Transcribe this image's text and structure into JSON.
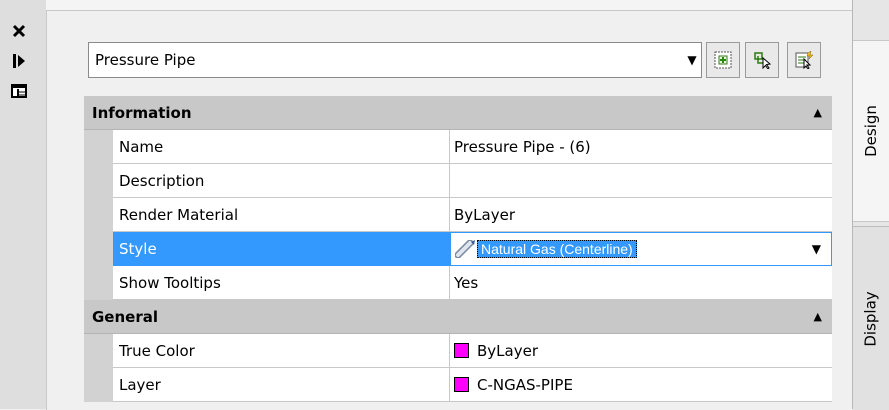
{
  "combo": {
    "value": "Pressure Pipe"
  },
  "tabs": {
    "design": "Design",
    "display": "Display"
  },
  "categories": [
    {
      "title": "Information",
      "rows": [
        {
          "name": "Name",
          "value": "Pressure Pipe - (6)"
        },
        {
          "name": "Description",
          "value": ""
        },
        {
          "name": "Render Material",
          "value": "ByLayer"
        },
        {
          "name": "Style",
          "value": "Natural Gas (Centerline)",
          "selected": true
        },
        {
          "name": "Show Tooltips",
          "value": "Yes"
        }
      ]
    },
    {
      "title": "General",
      "rows": [
        {
          "name": "True Color",
          "value": "ByLayer",
          "swatch": "#ff00ff"
        },
        {
          "name": "Layer",
          "value": "C-NGAS-PIPE",
          "swatch": "#ff00ff"
        }
      ]
    }
  ],
  "colors": {
    "selection": "#3399ff",
    "category_bg": "#c8c8c8",
    "swatch": "#ff00ff"
  }
}
